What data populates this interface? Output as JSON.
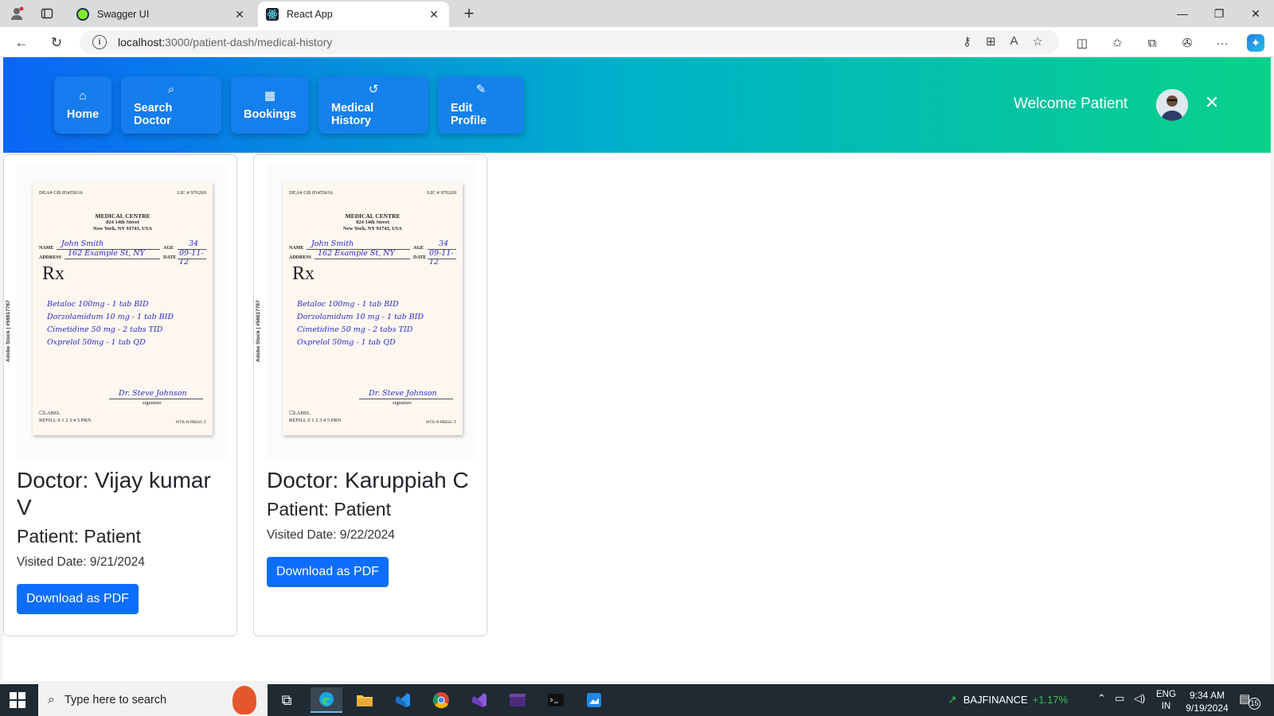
{
  "browser": {
    "tabs": [
      {
        "title": "Swagger UI",
        "favicon_color": "#85ea2d"
      },
      {
        "title": "React App",
        "favicon_color": "#20232a"
      }
    ],
    "new_tab": "+",
    "url_host": "localhost:",
    "url_path": "3000/patient-dash/medical-history"
  },
  "navbar": {
    "items": [
      {
        "label": "Home",
        "icon": "home-icon",
        "glyph": "⌂"
      },
      {
        "label": "Search Doctor",
        "icon": "search-icon",
        "glyph": "⌕"
      },
      {
        "label": "Bookings",
        "icon": "calendar-icon",
        "glyph": "▦"
      },
      {
        "label": "Medical History",
        "icon": "history-icon",
        "glyph": "↺"
      },
      {
        "label": "Edit Profile",
        "icon": "pencil-icon",
        "glyph": "✎"
      }
    ],
    "welcome": "Welcome Patient",
    "close_glyph": "✕",
    "gradient": [
      "#0a66f5",
      "#00b2c9",
      "#08d18a"
    ]
  },
  "prescription": {
    "dea": "DEA# GB 05455616",
    "lic": "LIC # 976269",
    "clinic": "MEDICAL CENTRE",
    "street": "824 14th Street",
    "city": "New York, NY 91743, USA",
    "name_label": "NAME",
    "name": "John Smith",
    "age_label": "AGE",
    "age": "34",
    "address_label": "ADDRESS",
    "address": "162 Example St, NY",
    "date_label": "DATE",
    "date": "09-11-12",
    "rx": "Rx",
    "meds": [
      "Betaloc 100mg - 1 tab BID",
      "Dorzolamidum 10 mg - 1 tab BID",
      "Cimetidine 50 mg - 2 tabs TID",
      "Oxprelol 50mg - 1 tab QD"
    ],
    "signer": "Dr. Steve Johnson",
    "signature_label": "signature",
    "label_box": "☐LABEL",
    "refill": "REFILL 0 1 2 3 4 5 PRN",
    "form_no": "WTX-N-PRESC-T",
    "side_text": "Adobe Stock | #56617767"
  },
  "records": [
    {
      "doctor": "Doctor: Vijay kumar V",
      "patient": "Patient: Patient",
      "visited": "Visited Date: 9/21/2024",
      "button": "Download as PDF"
    },
    {
      "doctor": "Doctor: Karuppiah C",
      "patient": "Patient: Patient",
      "visited": "Visited Date: 9/22/2024",
      "button": "Download as PDF"
    }
  ],
  "taskbar": {
    "search_placeholder": "Type here to search",
    "ticker_symbol": "BAJFINANCE",
    "ticker_change": "+1.17%",
    "lang_top": "ENG",
    "lang_bottom": "IN",
    "time": "9:34 AM",
    "date": "9/19/2024",
    "notifications": "15"
  }
}
